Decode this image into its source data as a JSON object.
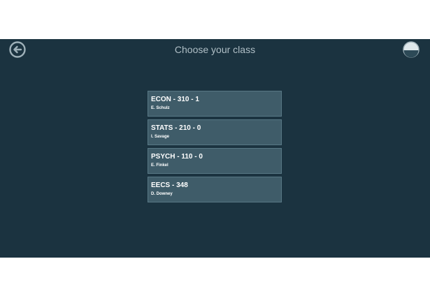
{
  "header": {
    "title": "Choose your class",
    "back_icon": "back-arrow-circle-icon",
    "profile_icon": "half-filled-circle-icon"
  },
  "classes": [
    {
      "code": "ECON - 310 - 1",
      "instructor": "E. Schulz"
    },
    {
      "code": "STATS - 210 - 0",
      "instructor": "I. Savage"
    },
    {
      "code": "PSYCH - 110 - 0",
      "instructor": "E. Finkel"
    },
    {
      "code": "EECS - 348",
      "instructor": "D. Downey"
    }
  ],
  "colors": {
    "background": "#1b3340",
    "card": "#3f5c69",
    "title_text": "#b0bfc6",
    "icon": "#9fb1b9"
  }
}
